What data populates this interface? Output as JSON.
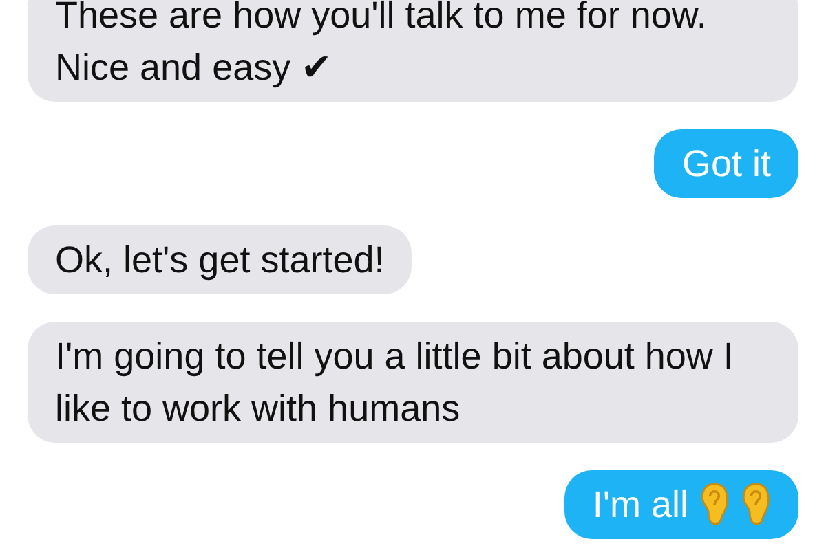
{
  "messages": [
    {
      "outgoing": false,
      "kind": "text",
      "text": "These are how you'll talk to me for now. Nice and easy ✔"
    },
    {
      "outgoing": true,
      "kind": "text",
      "text": "Got it"
    },
    {
      "outgoing": false,
      "kind": "text",
      "text": "Ok, let's get started!"
    },
    {
      "outgoing": false,
      "kind": "text",
      "text": "I'm going to tell you a little bit about how I like to work with humans"
    },
    {
      "outgoing": true,
      "kind": "text_with_ears",
      "text": "I'm all"
    }
  ]
}
